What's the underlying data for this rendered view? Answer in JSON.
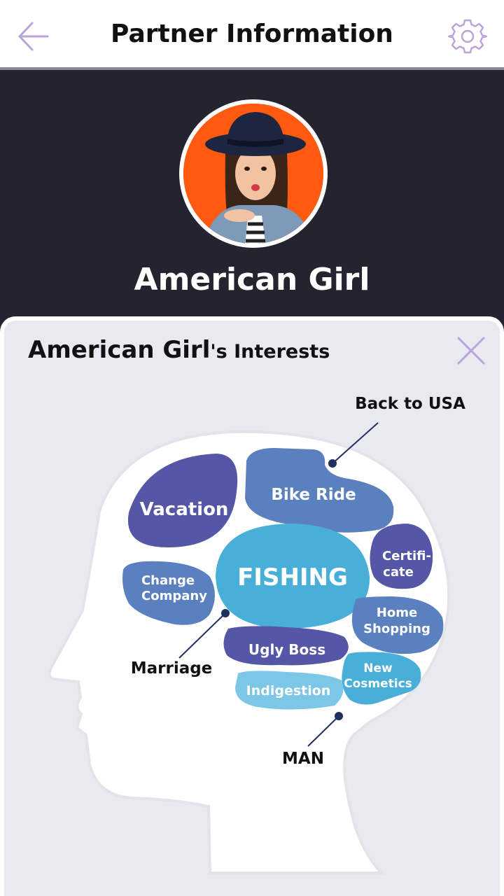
{
  "header": {
    "title": "Partner Information",
    "back_icon": "arrow-left-icon",
    "settings_icon": "gear-icon"
  },
  "profile": {
    "name": "American Girl",
    "avatar_background": "#ff5a10"
  },
  "interests_panel": {
    "owner_name": "American Girl",
    "title_suffix": "'s Interests",
    "close_icon": "close-icon",
    "main_interest": "FISHING",
    "bubbles": {
      "vacation": "Vacation",
      "bike_ride": "Bike Ride",
      "certificate_line1": "Certifi-",
      "certificate_line2": "cate",
      "change_company_line1": "Change",
      "change_company_line2": "Company",
      "home_shopping_line1": "Home",
      "home_shopping_line2": "Shopping",
      "ugly_boss": "Ugly Boss",
      "new_cosmetics_line1": "New",
      "new_cosmetics_line2": "Cosmetics",
      "indigestion": "Indigestion"
    },
    "callouts": {
      "back_to_usa": "Back to USA",
      "marriage": "Marriage",
      "man": "MAN"
    }
  },
  "colors": {
    "dark_bg": "#23242f",
    "panel_bg": "#e9eaef",
    "purple": "#5556a6",
    "mid_blue": "#5b80c0",
    "cyan": "#4aafd8",
    "light_blue": "#7cc6e6",
    "icon_lilac": "#b9a4dc"
  }
}
